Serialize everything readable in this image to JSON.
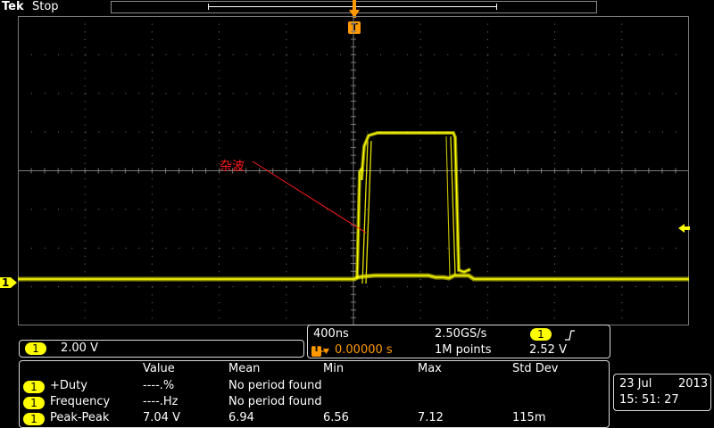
{
  "header": {
    "brand": "Tek",
    "status": "Stop"
  },
  "annotation": {
    "label": "杂波",
    "color": "#ff1a1a"
  },
  "colors": {
    "ch1": "#ffff00",
    "trigger": "#ff9900",
    "grid": "#7a7a7a",
    "panel_border": "#d9d9d9"
  },
  "markers": {
    "trigger_top": "T",
    "ch1_ground": "1",
    "trigger_level_icon": "arrow-left-icon"
  },
  "channel": {
    "badge": "1",
    "scale": "2.00 V"
  },
  "timebase": {
    "horizontal_scale": "400ns",
    "sample_rate": "2.50GS/s",
    "trigger_badge": "1",
    "trigger_slope_icon": "rising-edge-icon",
    "trigger_level": "2.52 V",
    "trigger_icon_label": "T",
    "delay": "0.00000 s",
    "record_length": "1M points"
  },
  "measurements": {
    "headers": [
      "Value",
      "Mean",
      "Min",
      "Max",
      "Std Dev"
    ],
    "rows": [
      {
        "badge": "1",
        "name": "+Duty",
        "value": "----.%",
        "mean": "No period found",
        "min": "",
        "max": "",
        "std": ""
      },
      {
        "badge": "1",
        "name": "Frequency",
        "value": "----.Hz",
        "mean": "No period found",
        "min": "",
        "max": "",
        "std": ""
      },
      {
        "badge": "1",
        "name": "Peak-Peak",
        "value": "7.04 V",
        "mean": "6.94",
        "min": "6.56",
        "max": "7.12",
        "std": "115m"
      }
    ]
  },
  "datetime": {
    "date": "23 Jul",
    "year": "2013",
    "time": "15: 51: 27"
  }
}
